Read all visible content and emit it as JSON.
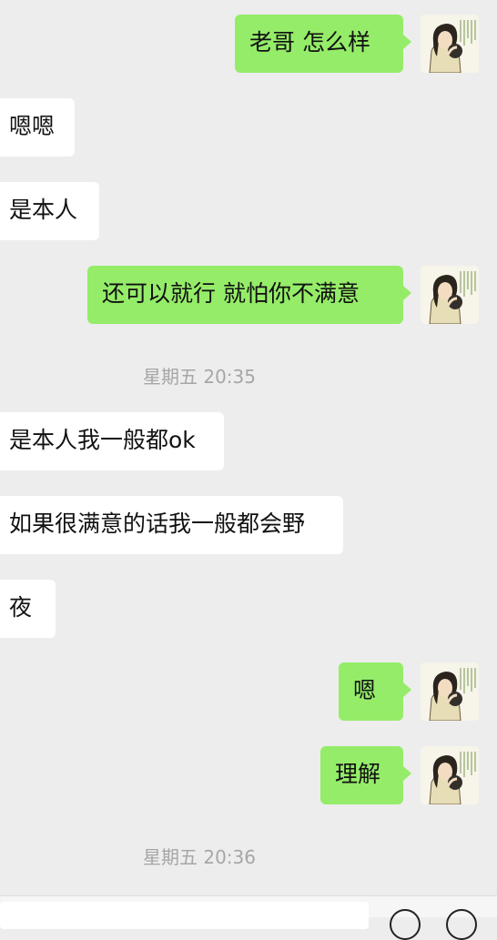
{
  "messages": [
    {
      "side": "out",
      "text": "老哥  怎么样"
    },
    {
      "side": "in",
      "text": "嗯嗯"
    },
    {
      "side": "in",
      "text": "是本人"
    },
    {
      "side": "out",
      "text": "还可以就行  就怕你不满意"
    },
    {
      "side": "time",
      "text": "星期五 20:35"
    },
    {
      "side": "in",
      "text": "是本人我一般都ok"
    },
    {
      "side": "in",
      "text": "如果很满意的话我一般都会野"
    },
    {
      "side": "in",
      "text": "夜"
    },
    {
      "side": "out",
      "text": "嗯"
    },
    {
      "side": "out",
      "text": "理解"
    },
    {
      "side": "time",
      "text": "星期五 20:36"
    }
  ],
  "colors": {
    "outgoing_bubble": "#95ec69",
    "incoming_bubble": "#ffffff",
    "background": "#ededed"
  },
  "icons": {
    "avatar": "avatar-icon",
    "voice": "voice-icon",
    "emoji": "emoji-icon"
  }
}
